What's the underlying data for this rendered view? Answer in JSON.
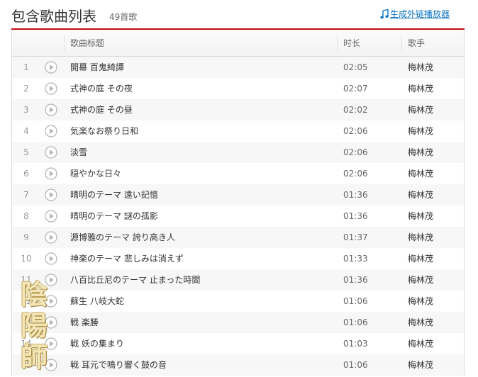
{
  "header": {
    "title": "包含歌曲列表",
    "count": "49首歌",
    "ext_link": "生成外链播放器",
    "ext_icon": "music-note-icon"
  },
  "columns": {
    "title": "歌曲标题",
    "duration": "时长",
    "singer": "歌手"
  },
  "songs": [
    {
      "num": "1",
      "name": "開幕 百鬼綺譚",
      "duration": "02:05",
      "singer": "梅林茂"
    },
    {
      "num": "2",
      "name": "式神の庭 その夜",
      "duration": "02:07",
      "singer": "梅林茂"
    },
    {
      "num": "3",
      "name": "式神の庭 その昼",
      "duration": "02:02",
      "singer": "梅林茂"
    },
    {
      "num": "4",
      "name": "気楽なお祭り日和",
      "duration": "02:06",
      "singer": "梅林茂"
    },
    {
      "num": "5",
      "name": "淡雪",
      "duration": "02:06",
      "singer": "梅林茂"
    },
    {
      "num": "6",
      "name": "穏やかな日々",
      "duration": "02:06",
      "singer": "梅林茂"
    },
    {
      "num": "7",
      "name": "晴明のテーマ 遠い記憶",
      "duration": "01:36",
      "singer": "梅林茂"
    },
    {
      "num": "8",
      "name": "晴明のテーマ 謎の孤影",
      "duration": "01:36",
      "singer": "梅林茂"
    },
    {
      "num": "9",
      "name": "源博雅のテーマ 誇り高き人",
      "duration": "01:37",
      "singer": "梅林茂"
    },
    {
      "num": "10",
      "name": "神楽のテーマ 悲しみは消えず",
      "duration": "01:33",
      "singer": "梅林茂"
    },
    {
      "num": "11",
      "name": "八百比丘尼のテーマ 止まった時間",
      "duration": "01:36",
      "singer": "梅林茂"
    },
    {
      "num": "12",
      "name": "蘇生 八岐大蛇",
      "duration": "01:06",
      "singer": "梅林茂"
    },
    {
      "num": "13",
      "name": "戦 楽勝",
      "duration": "01:06",
      "singer": "梅林茂"
    },
    {
      "num": "14",
      "name": "戦 妖の集まり",
      "duration": "01:03",
      "singer": "梅林茂"
    },
    {
      "num": "15",
      "name": "戦 耳元で鳴り響く鼓の音",
      "duration": "01:06",
      "singer": "梅林茂"
    }
  ],
  "watermark": [
    "陰",
    "陽",
    "師"
  ],
  "colors": {
    "accent_red": "#c20c0c",
    "link_blue": "#0c73c2",
    "row_odd": "#f7f7f7",
    "row_even": "#ffffff"
  }
}
